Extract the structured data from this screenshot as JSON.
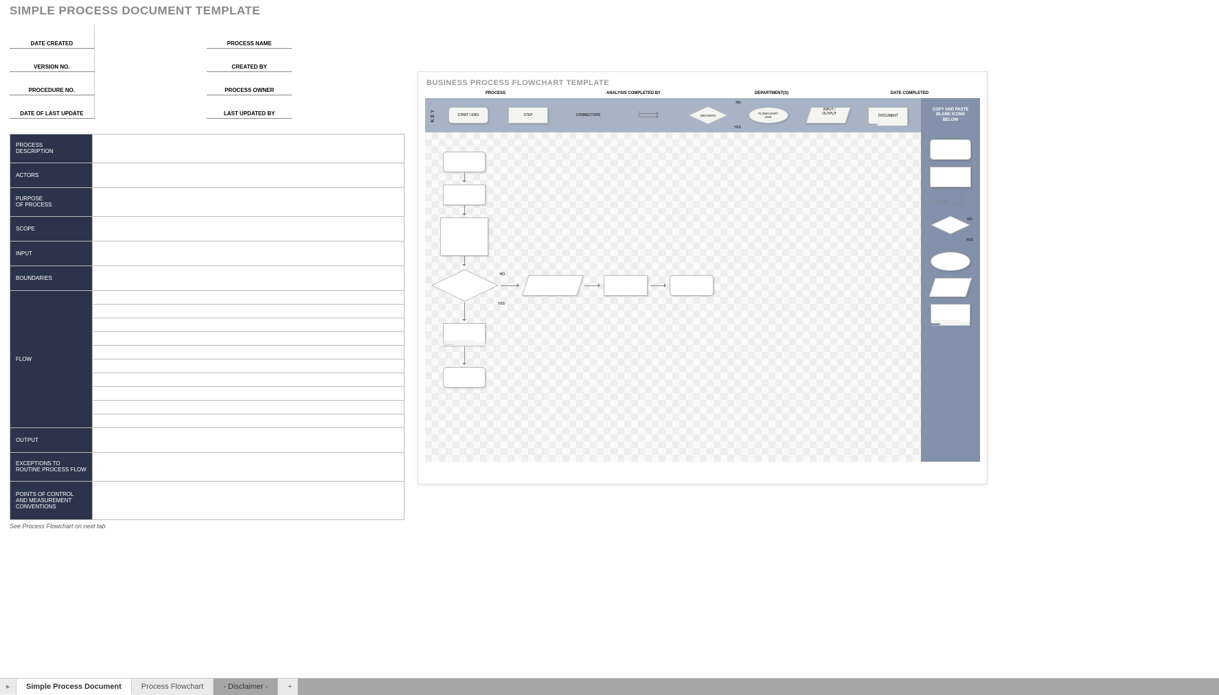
{
  "doc_title": "SIMPLE PROCESS DOCUMENT TEMPLATE",
  "meta": {
    "date_created": "DATE CREATED",
    "process_name": "PROCESS NAME",
    "version_no": "VERSION NO.",
    "created_by": "CREATED BY",
    "procedure_no": "PROCEDURE NO.",
    "process_owner": "PROCESS OWNER",
    "date_last_update": "DATE OF LAST UPDATE",
    "last_updated_by": "LAST UPDATED BY"
  },
  "sections": {
    "process_description": "PROCESS\nDESCRIPTION",
    "actors": "ACTORS",
    "purpose": "PURPOSE\nOF PROCESS",
    "scope": "SCOPE",
    "input": "INPUT",
    "boundaries": "BOUNDARIES",
    "flow": "FLOW",
    "output": "OUTPUT",
    "exceptions": "EXCEPTIONS TO\nROUTINE PROCESS FLOW",
    "points": "POINTS OF CONTROL\nAND MEASUREMENT\nCONVENTIONS"
  },
  "footnote": "See Process Flowchart on next tab",
  "flowchart": {
    "title": "BUSINESS PROCESS FLOWCHART TEMPLATE",
    "headers": {
      "process": "PROCESS",
      "analysis": "ANALYSIS COMPLETED BY",
      "department": "DEPARTMENT(S)",
      "date": "DATE COMPLETED"
    },
    "key": {
      "label": "KEY",
      "start_end": "START / END",
      "step": "STEP",
      "connectors": "CONNECTORS",
      "decision": "DECISION",
      "no": "NO",
      "yes": "YES",
      "flowchart_link": "FLOWCHART\nLINK",
      "input_output": "INPUT /\nOUTPUT",
      "document": "DOCUMENT"
    },
    "copy_header": "COPY AND PASTE\nBLANK ICONS\nBELOW"
  },
  "tabs": {
    "t1": "Simple Process Document",
    "t2": "Process Flowchart",
    "t3": "- Disclaimer -",
    "add": "+",
    "start": "▸"
  }
}
